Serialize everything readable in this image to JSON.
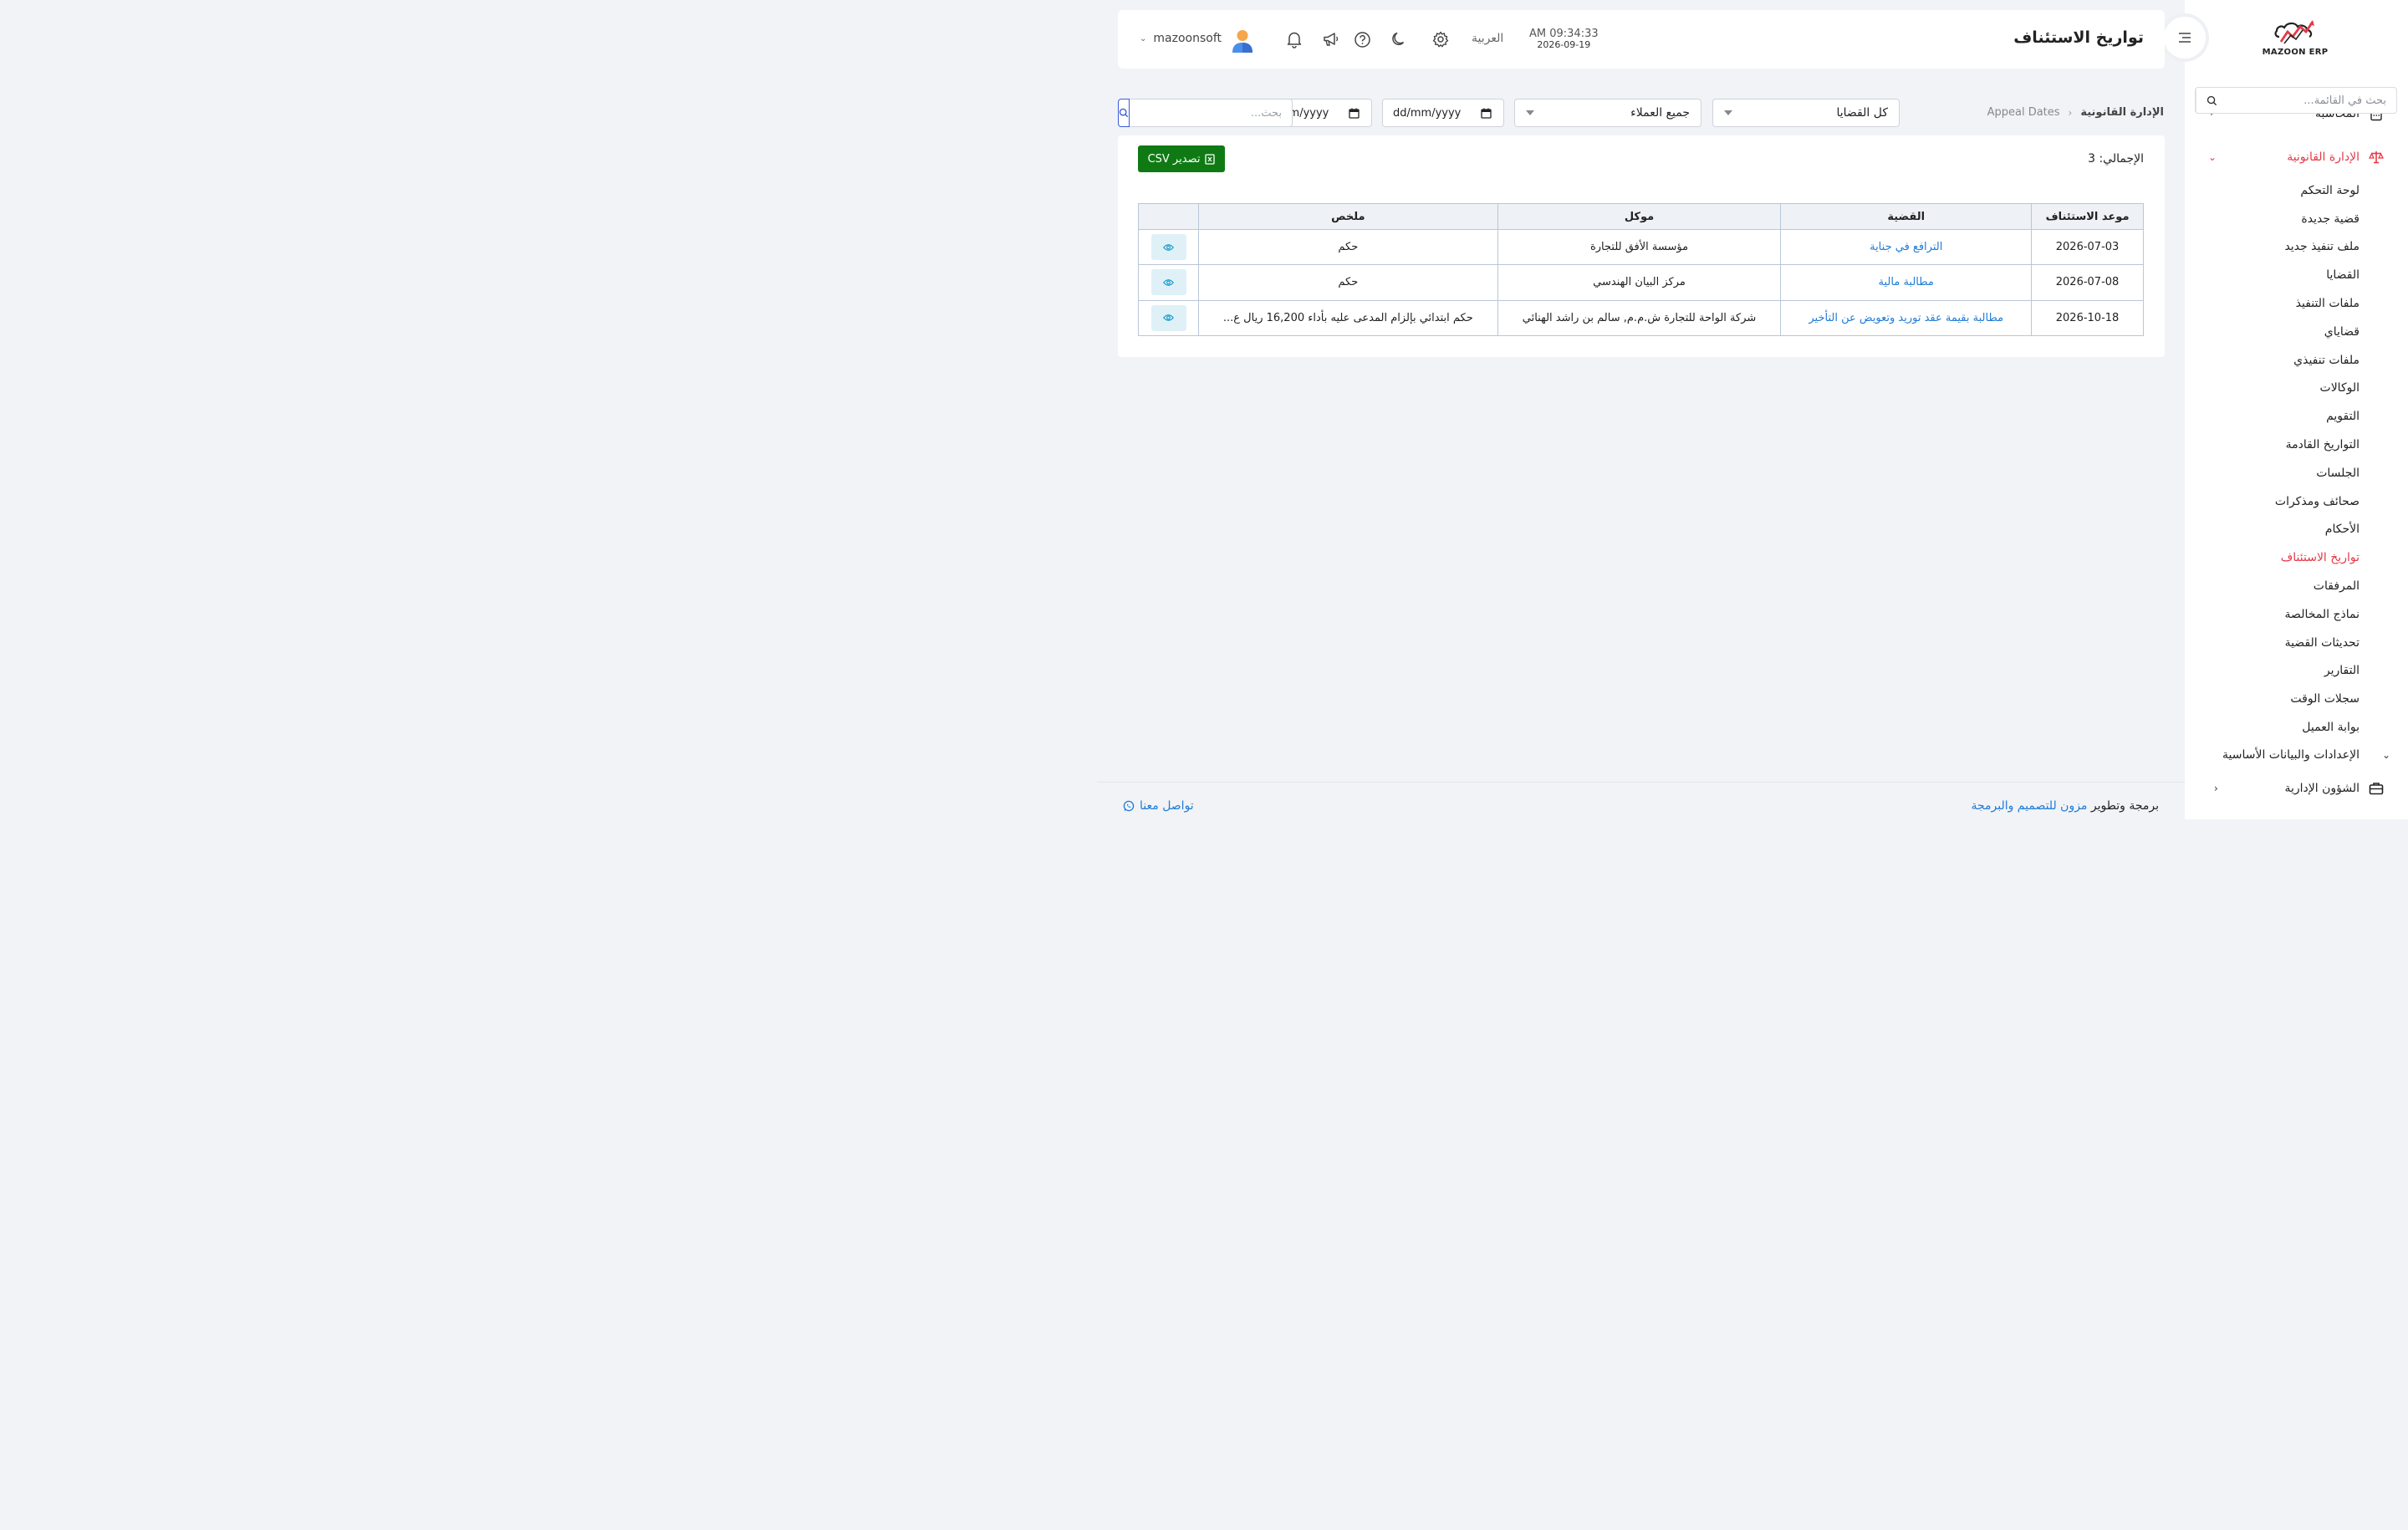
{
  "header": {
    "title": "تواريخ الاستئناف",
    "time": "AM 09:34:33",
    "date": "2026-09-19",
    "language": "العربية",
    "username": "mazoonsoft",
    "icons": [
      "settings-icon",
      "moon-icon",
      "help-icon",
      "megaphone-icon",
      "bell-icon"
    ]
  },
  "logo": {
    "text": "MAZOON ERP",
    "brand_color": "#e63946"
  },
  "sidebar": {
    "search_placeholder": "بحث في القائمة...",
    "cut_item": "المحاسبة",
    "legal_group": "الإدارة القانونية",
    "legal_items": [
      {
        "label": "لوحة التحكم"
      },
      {
        "label": "قضية جديدة"
      },
      {
        "label": "ملف تنفيذ جديد"
      },
      {
        "label": "القضايا"
      },
      {
        "label": "ملفات التنفيذ"
      },
      {
        "label": "قضاياي"
      },
      {
        "label": "ملفات تنفيذي"
      },
      {
        "label": "الوكالات"
      },
      {
        "label": "التقويم"
      },
      {
        "label": "التواريخ القادمة"
      },
      {
        "label": "الجلسات"
      },
      {
        "label": "صحائف ومذكرات"
      },
      {
        "label": "الأحكام"
      },
      {
        "label": "تواريخ الاستئناف"
      },
      {
        "label": "المرفقات"
      },
      {
        "label": "نماذج المخالصة"
      },
      {
        "label": "تحديثات القضية"
      },
      {
        "label": "التقارير"
      },
      {
        "label": "سجلات الوقت"
      },
      {
        "label": "بوابة العميل"
      }
    ],
    "active_item": "تواريخ الاستئناف",
    "settings_group": "الإعدادات والبيانات الأساسية",
    "admin_group": "الشؤون الإدارية"
  },
  "breadcrumb": {
    "parent": "الإدارة القانونية",
    "current": "Appeal Dates"
  },
  "filters": {
    "cases_select": "كل القضايا",
    "clients_select": "جميع العملاء",
    "date_from_placeholder": "dd/mm/yyyy",
    "date_to_placeholder": "dd/mm/yyyy",
    "search_placeholder": "بحث..."
  },
  "card": {
    "total_label": "الإجمالي: 3",
    "export_label": "تصدير CSV"
  },
  "table": {
    "columns": [
      "موعد الاستئناف",
      "القضية",
      "موكل",
      "ملخص",
      ""
    ],
    "rows": [
      {
        "date": "2026-07-03",
        "case": "الترافع في جناية",
        "client": "مؤسسة الأفق للتجارة",
        "summary": "حكم"
      },
      {
        "date": "2026-07-08",
        "case": "مطالبة مالية",
        "client": "مركز البيان الهندسي",
        "summary": "حكم"
      },
      {
        "date": "2026-10-18",
        "case": "مطالبة بقيمة عقد توريد وتعويض عن التأخير",
        "client": "شركة الواحة للتجارة ش.م.م, سالم بن راشد الهنائي",
        "summary": "حكم ابتدائي بإلزام المدعى عليه بأداء 16,200 ريال ع..."
      }
    ]
  },
  "footer": {
    "credit_prefix": "برمجة وتطوير",
    "credit_link": "مزون للتصميم والبرمجة",
    "contact": "تواصل معنا"
  },
  "colors": {
    "accent_red": "#e63946",
    "link_blue": "#1f7bd6",
    "export_green": "#0f7a14",
    "search_blue": "#3b5bdb"
  }
}
